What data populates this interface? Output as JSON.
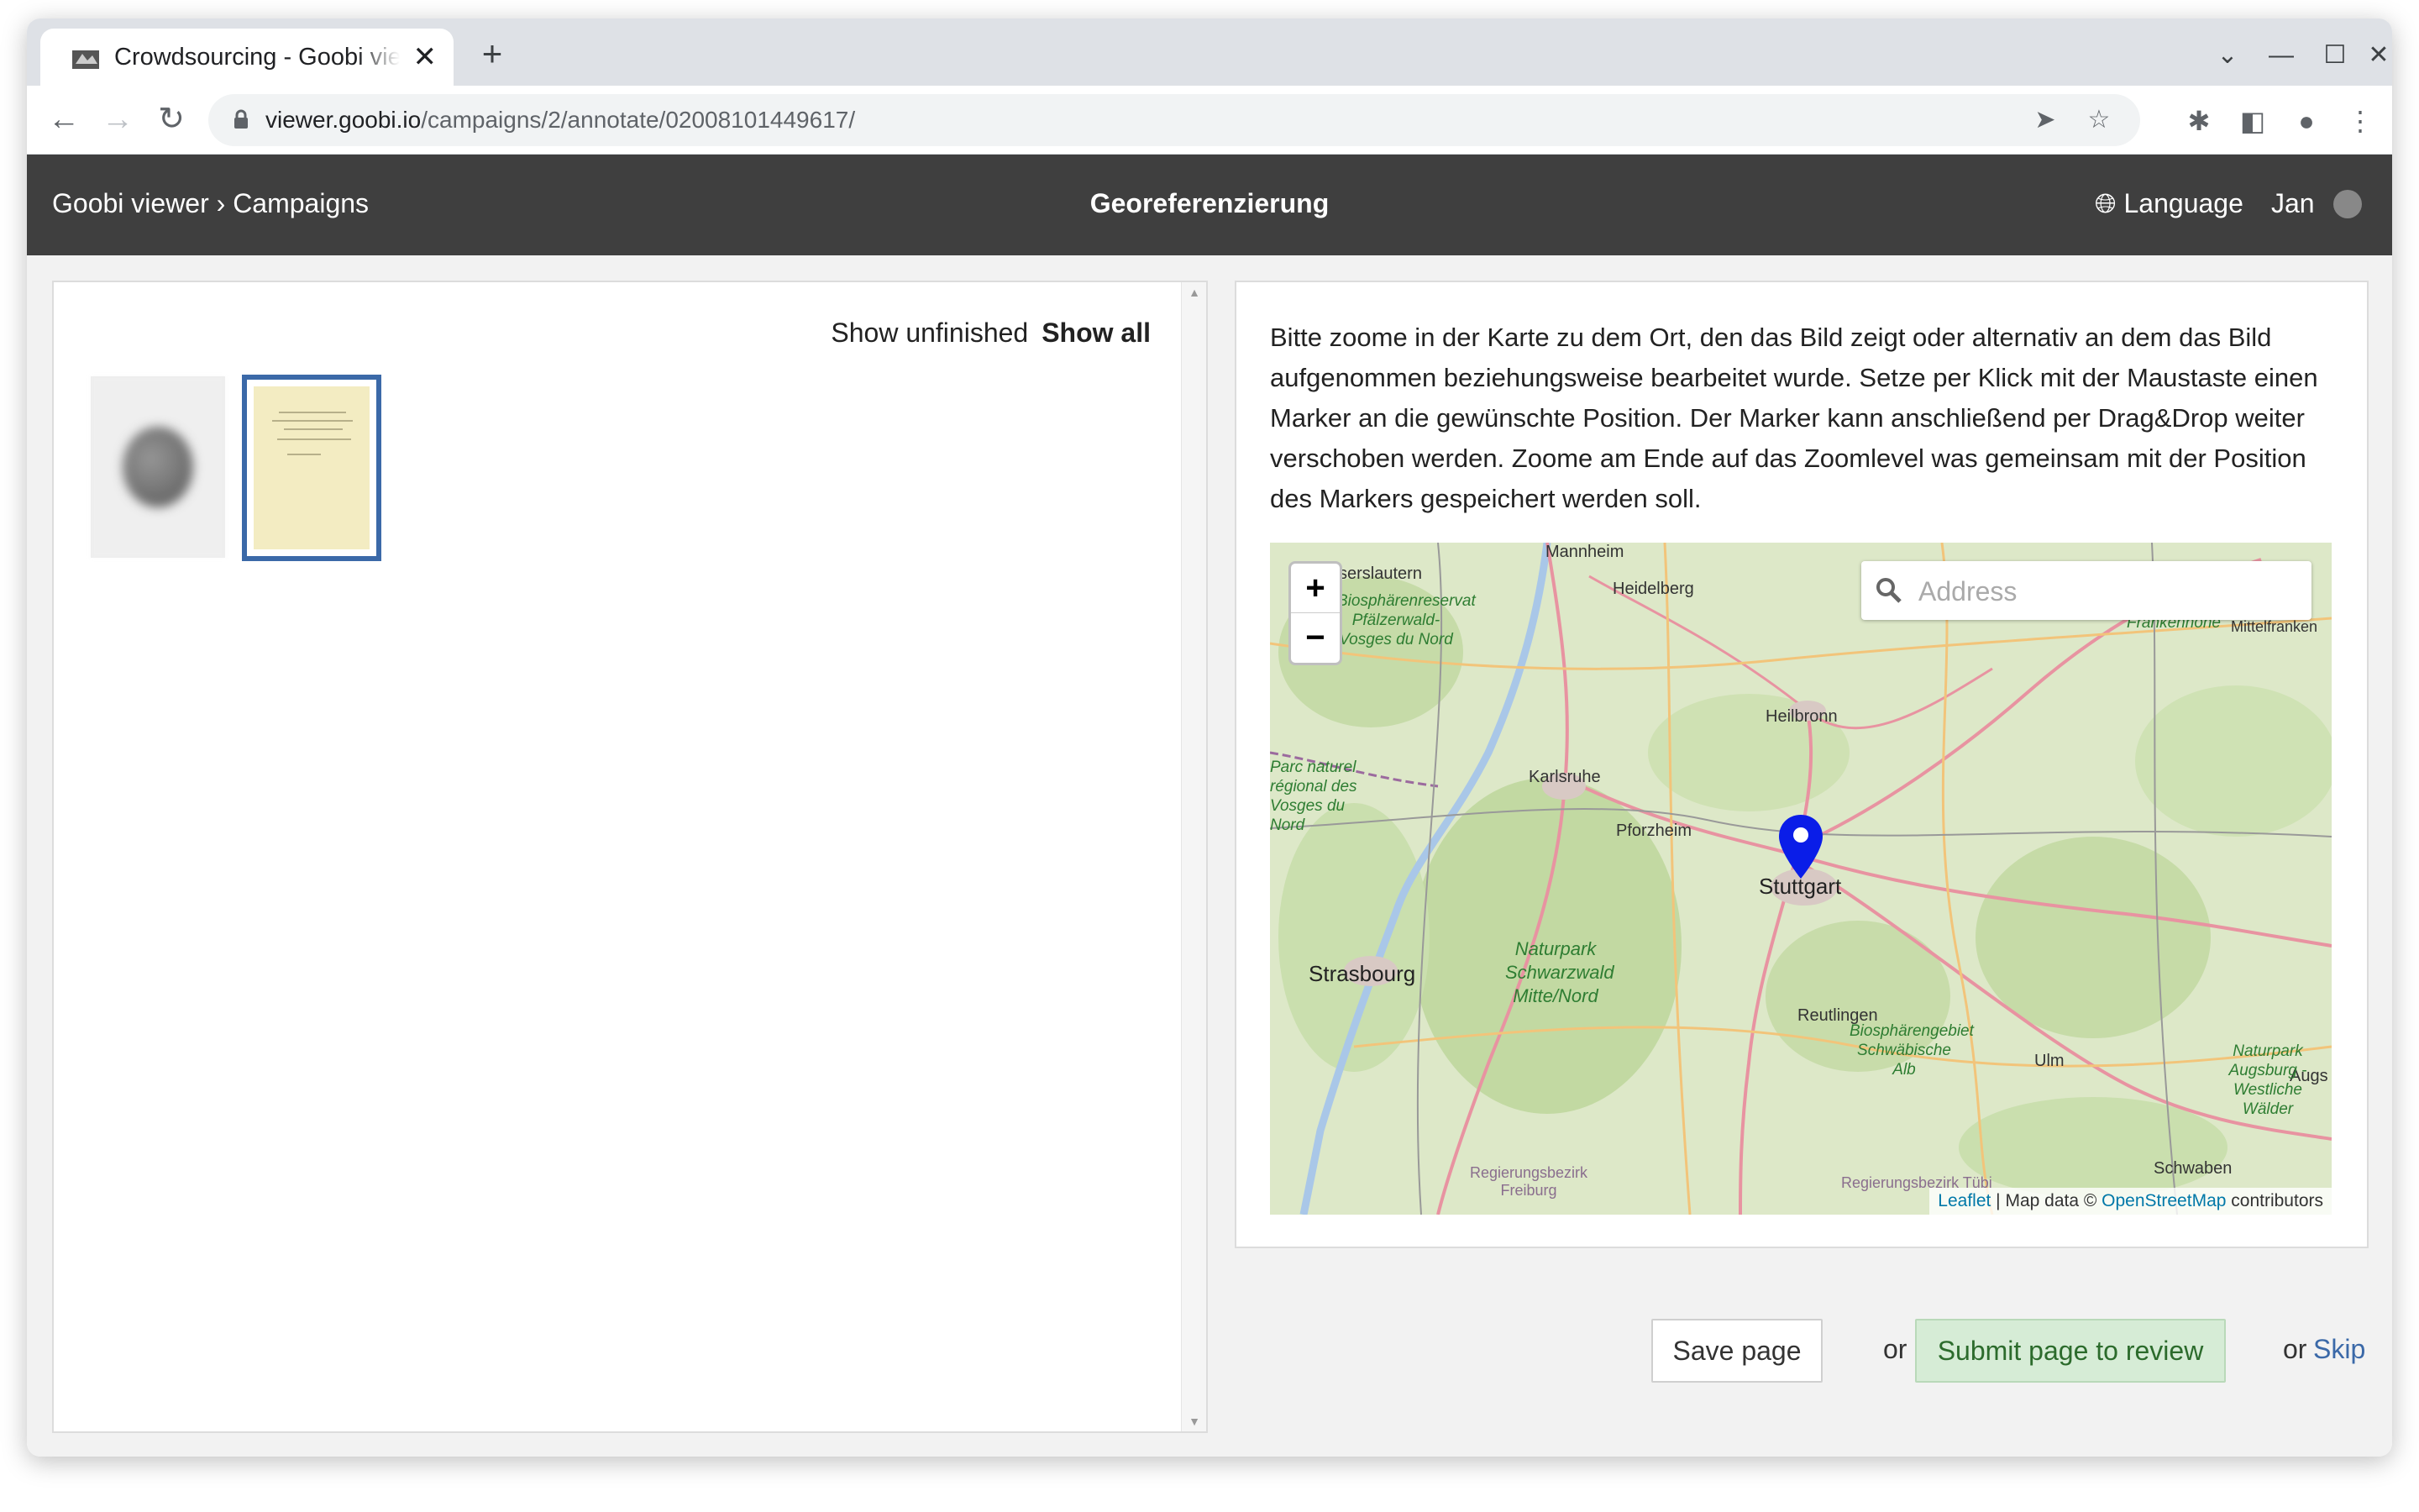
{
  "browser": {
    "tab_title": "Crowdsourcing - Goobi viewer",
    "url_host": "viewer.goobi.io",
    "url_path": "/campaigns/2/annotate/02008101449617/"
  },
  "header": {
    "breadcrumb": "Goobi viewer › Campaigns",
    "title": "Georeferenzierung",
    "language_label": "Language",
    "user_name": "Jan"
  },
  "left": {
    "filter_unfinished": "Show unfinished",
    "filter_all": "Show all"
  },
  "right": {
    "instructions": "Bitte zoome in der Karte zu dem Ort, den das Bild zeigt oder alternativ an dem das Bild aufgenommen beziehungsweise bearbeitet wurde. Setze per Klick mit der Maustaste einen Marker an die gewünschte Position. Der Marker kann anschließend per Drag&Drop weiter verschoben werden. Zoome am Ende auf das Zoomlevel was gemeinsam mit der Position des Markers gespeichert werden soll.",
    "map": {
      "zoom_in": "+",
      "zoom_out": "−",
      "search_placeholder": "Address",
      "attribution_leaflet": "Leaflet",
      "attribution_sep": " | Map data © ",
      "attribution_osm": "OpenStreetMap",
      "attribution_tail": " contributors",
      "labels": {
        "mannheim": "Mannheim",
        "kaiserslautern": "serslautern",
        "heidelberg": "Heidelberg",
        "heilbronn": "Heilbronn",
        "karlsruhe": "Karlsruhe",
        "pforzheim": "Pforzheim",
        "stuttgart": "Stuttgart",
        "strasbourg": "Strasbourg",
        "reutlingen": "Reutlingen",
        "ulm": "Ulm",
        "schwaben": "Schwaben",
        "augs": "Augs",
        "freiburg": "Regierungsbezirk Freiburg",
        "tubingen": "Regierungsbezirk Tübi",
        "mittelfranken": "Mittelfranken",
        "frankenhohe": "Frankenhöhe",
        "pfalzerwald": "Biosphärenreservat Pfälzerwald- Vosges du Nord",
        "vosges": "Parc naturel régional des Vosges du Nord",
        "schwarzwald": "Naturpark Schwarzwald Mitte/Nord",
        "schwabische": "Biosphärengebiet Schwäbische Alb",
        "augsburg": "Naturpark Augsburg - Westliche Wälder"
      }
    }
  },
  "actions": {
    "save": "Save page",
    "or1": "or",
    "submit": "Submit page to review",
    "or2": "or",
    "skip": "Skip"
  }
}
